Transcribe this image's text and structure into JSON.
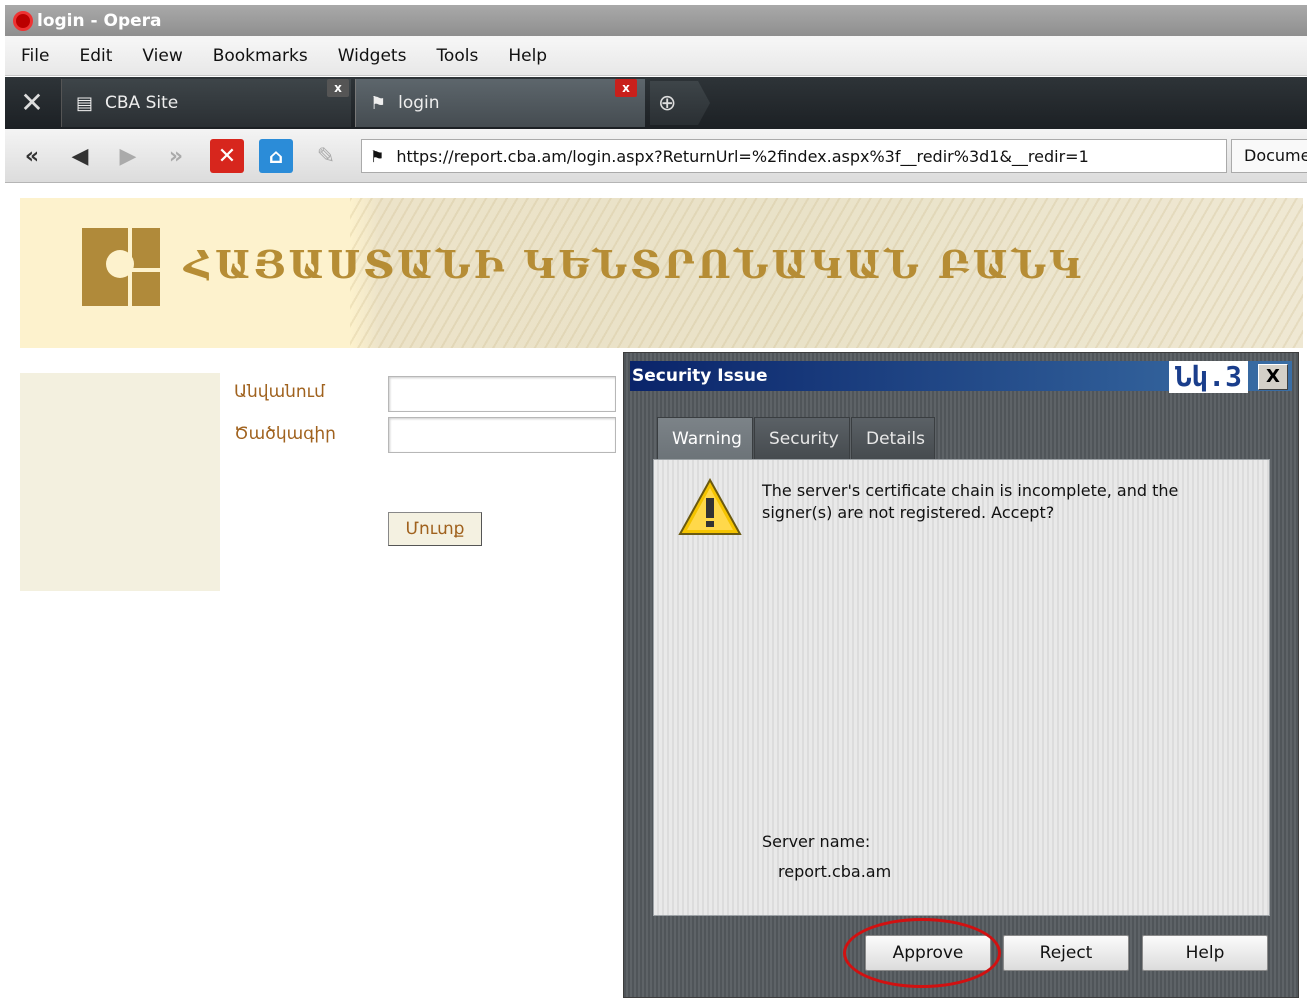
{
  "window": {
    "title": "login - Opera"
  },
  "menubar": {
    "items": [
      "File",
      "Edit",
      "View",
      "Bookmarks",
      "Widgets",
      "Tools",
      "Help"
    ]
  },
  "tabs": [
    {
      "label": "CBA Site",
      "icon": "document-icon",
      "close": "x"
    },
    {
      "label": "login",
      "icon": "security-badge-icon",
      "close": "x"
    }
  ],
  "toolbar": {
    "url": "https://report.cba.am/login.aspx?ReturnUrl=%2findex.aspx%3f__redir%3d1&__redir=1",
    "search_text": "Docume"
  },
  "page": {
    "bank_name": "ՀԱՅԱՍՏԱՆԻ ԿԵՆՏՐՈՆԱԿԱՆ ԲԱՆԿ",
    "username_label": "Անվանում",
    "password_label": "Ծածկագիր",
    "submit_label": "Մուտք"
  },
  "dialog": {
    "title": "Security Issue",
    "figure_label": "Նկ.3",
    "close": "X",
    "tabs": [
      "Warning",
      "Security",
      "Details"
    ],
    "active_tab": "Warning",
    "message": "The server's certificate chain is incomplete, and the signer(s) are not registered. Accept?",
    "server_name_label": "Server name:",
    "server_name": "report.cba.am",
    "buttons": {
      "approve": "Approve",
      "reject": "Reject",
      "help": "Help"
    },
    "highlight_color": "#d11111"
  }
}
